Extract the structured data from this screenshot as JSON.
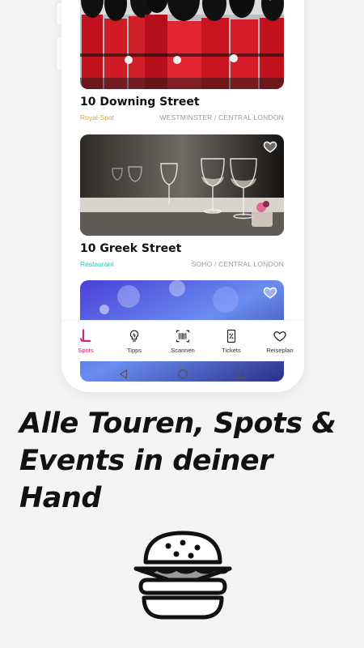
{
  "cards": [
    {
      "title": "10 Downing Street",
      "category": "Royal-Spot",
      "category_color": "#e0a43a",
      "location": "WESTMINSTER / CENTRAL LONDON"
    },
    {
      "title": "10 Greek Street",
      "category": "Restaurant",
      "category_color": "#2ec4a9",
      "location": "SOHO / CENTRAL LONDON"
    },
    {
      "title": "",
      "category": "",
      "location": ""
    }
  ],
  "nav": {
    "items": [
      {
        "label": "Spots",
        "icon": "spots-icon",
        "active": true
      },
      {
        "label": "Tipps",
        "icon": "lightbulb-icon"
      },
      {
        "label": "Scannen",
        "icon": "barcode-icon"
      },
      {
        "label": "Tickets",
        "icon": "ticket-icon"
      },
      {
        "label": "Reiseplan",
        "icon": "heart-icon"
      }
    ],
    "active_color": "#d6227a"
  },
  "headline": {
    "line1": "Alle Touren, Spots &",
    "line2": "Events in deiner",
    "line3": "Hand"
  }
}
